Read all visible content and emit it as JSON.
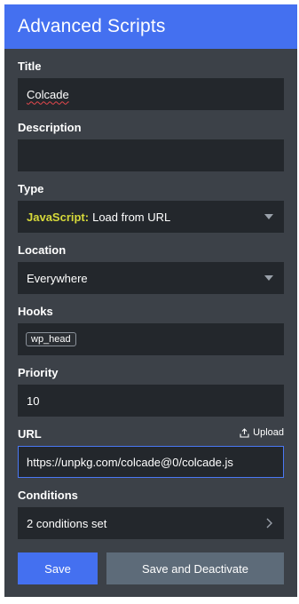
{
  "header": {
    "title": "Advanced Scripts"
  },
  "fields": {
    "title": {
      "label": "Title",
      "value": "Colcade"
    },
    "description": {
      "label": "Description",
      "value": ""
    },
    "type": {
      "label": "Type",
      "language": "JavaScript:",
      "value": "Load from URL"
    },
    "location": {
      "label": "Location",
      "value": "Everywhere"
    },
    "hooks": {
      "label": "Hooks",
      "chips": [
        "wp_head"
      ]
    },
    "priority": {
      "label": "Priority",
      "value": "10"
    },
    "url": {
      "label": "URL",
      "upload_label": "Upload",
      "value": "https://unpkg.com/colcade@0/colcade.js"
    },
    "conditions": {
      "label": "Conditions",
      "value": "2 conditions set"
    }
  },
  "buttons": {
    "save": "Save",
    "save_deactivate": "Save and Deactivate"
  },
  "colors": {
    "accent": "#4470f0",
    "panel_bg": "#3c4148",
    "input_bg": "#23272c",
    "js_tag": "#d6d93a"
  },
  "icons": {
    "type_dropdown": "caret-down-icon",
    "location_dropdown": "caret-down-icon",
    "upload": "upload-icon",
    "conditions": "chevron-right-icon"
  }
}
